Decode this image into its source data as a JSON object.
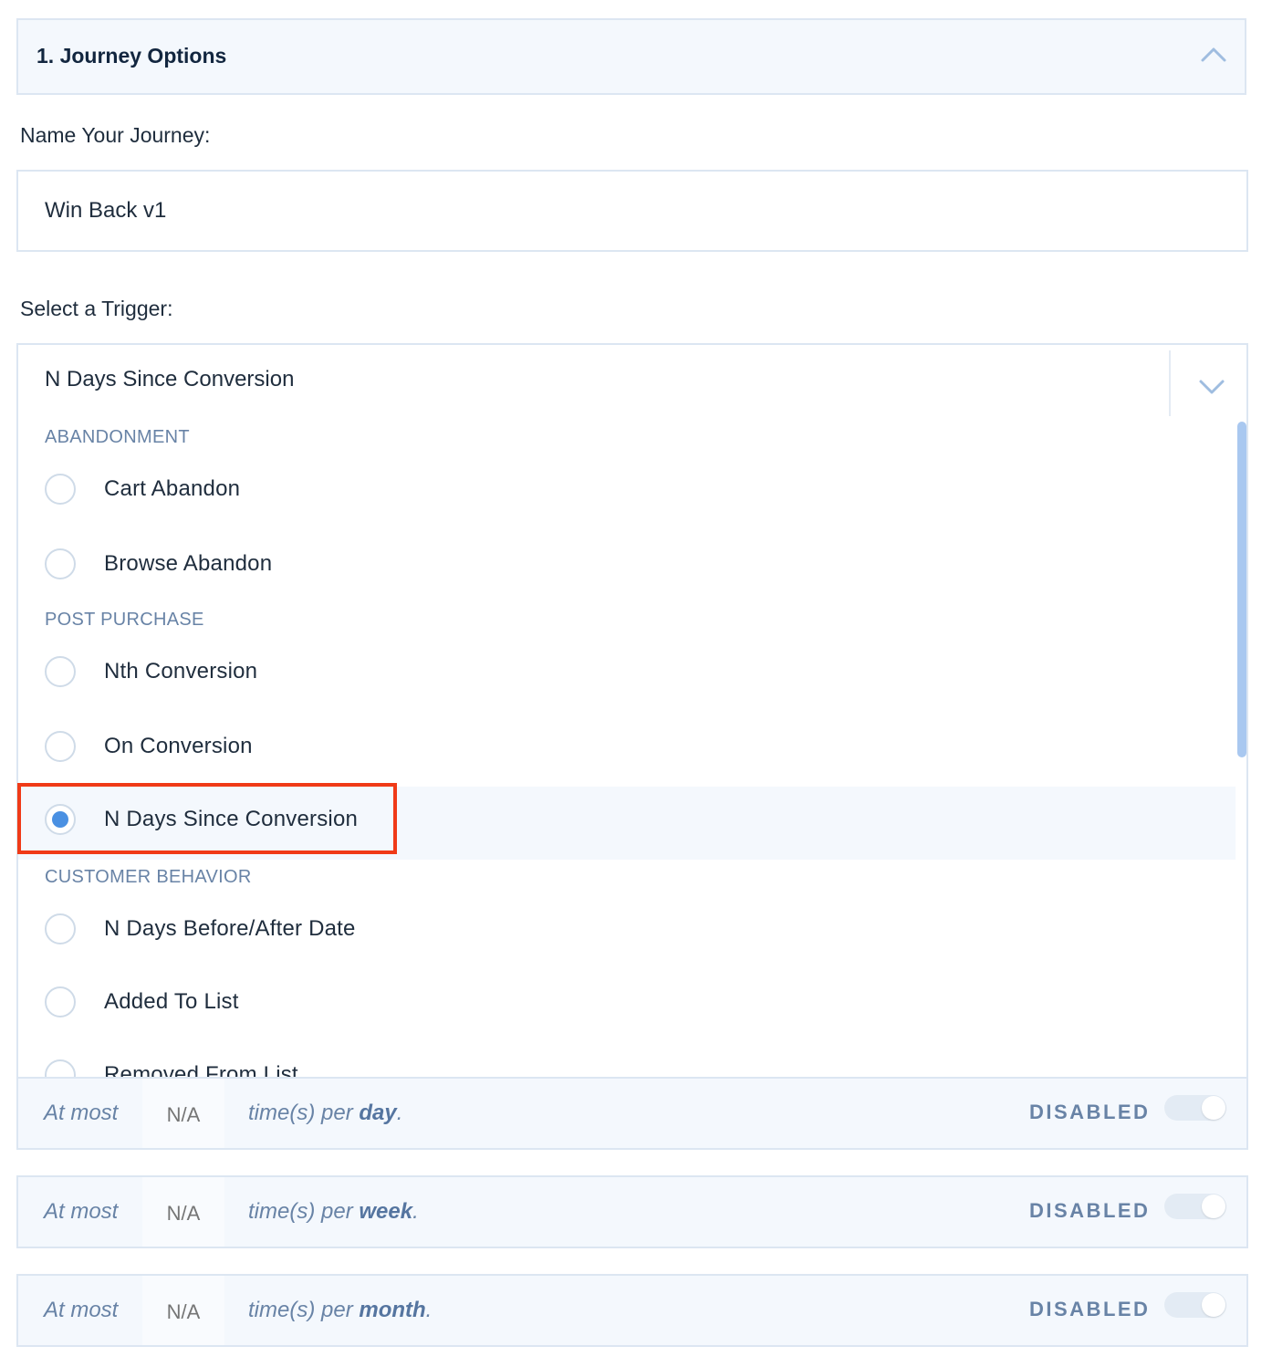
{
  "section": {
    "title": "1. Journey Options"
  },
  "name_field": {
    "label": "Name Your Journey:",
    "value": "Win Back v1"
  },
  "trigger_field": {
    "label": "Select a Trigger:",
    "selected_value": "N Days Since Conversion",
    "groups": [
      {
        "label": "ABANDONMENT",
        "options": [
          "Cart Abandon",
          "Browse Abandon"
        ]
      },
      {
        "label": "POST PURCHASE",
        "options": [
          "Nth Conversion",
          "On Conversion",
          "N Days Since Conversion"
        ]
      },
      {
        "label": "CUSTOMER BEHAVIOR",
        "options": [
          "N Days Before/After Date",
          "Added To List",
          "Removed From List"
        ]
      }
    ]
  },
  "frequency_limits": [
    {
      "prefix": "At most",
      "value": "N/A",
      "suffix": "time(s) per",
      "period": "day",
      "status": "DISABLED"
    },
    {
      "prefix": "At most",
      "value": "N/A",
      "suffix": "time(s) per",
      "period": "week",
      "status": "DISABLED"
    },
    {
      "prefix": "At most",
      "value": "N/A",
      "suffix": "time(s) per",
      "period": "month",
      "status": "DISABLED"
    }
  ],
  "colors": {
    "accent": "#4a90e2",
    "highlight_border": "#f03a17",
    "muted_text": "#6883a6",
    "panel_bg": "#f4f8fd"
  },
  "icons": {
    "collapse": "chevron-up-icon",
    "dropdown": "chevron-down-icon"
  }
}
